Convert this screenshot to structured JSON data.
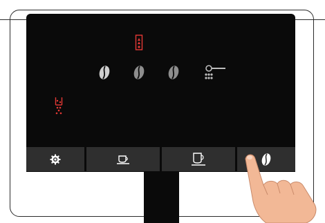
{
  "display": {
    "alerts": {
      "top_icon": "water-tank-alert-icon",
      "left_icon": "grounds-container-alert-icon",
      "color": "#e53935"
    },
    "strength_icons": [
      "coffee-bean-icon",
      "coffee-bean-icon",
      "coffee-bean-icon"
    ],
    "grind_icon": "ground-coffee-icon",
    "icon_color": "#c8c8c8"
  },
  "buttons": [
    {
      "name": "settings",
      "icon": "gear-icon"
    },
    {
      "name": "espresso",
      "icon": "small-cup-icon"
    },
    {
      "name": "coffee",
      "icon": "large-cup-icon"
    },
    {
      "name": "strength",
      "icon": "coffee-bean-icon",
      "pressed": true
    }
  ],
  "colors": {
    "screen": "#0a0a0a",
    "button": "#2f2f2f",
    "skin": "#f2b896"
  }
}
